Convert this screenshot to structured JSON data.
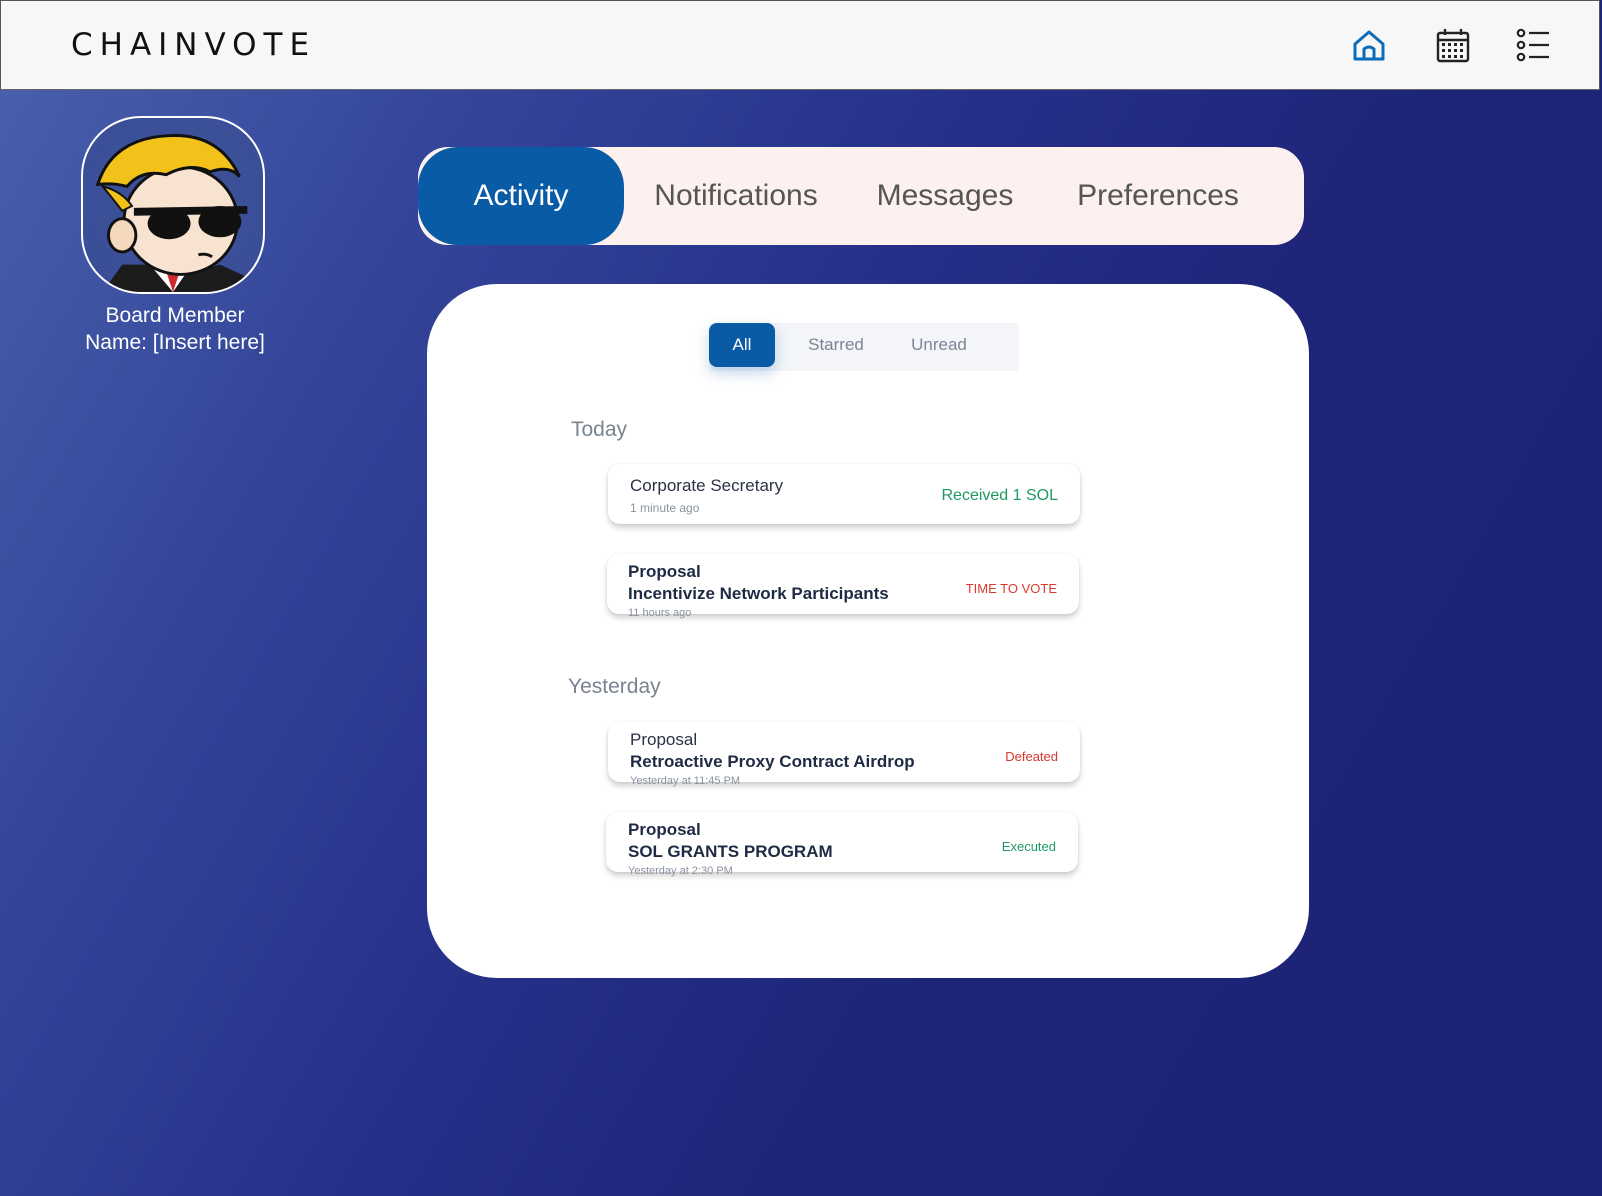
{
  "app": {
    "logo": "CHAINVOTE"
  },
  "nav": {
    "icons": [
      {
        "name": "home-icon",
        "color": "#0a6bb8"
      },
      {
        "name": "calendar-icon",
        "color": "#222222"
      },
      {
        "name": "list-icon",
        "color": "#222222"
      }
    ]
  },
  "profile": {
    "role": "Board Member",
    "name_line": "Name: [Insert here]"
  },
  "tabs": [
    {
      "label": "Activity",
      "active": true
    },
    {
      "label": "Notifications",
      "active": false
    },
    {
      "label": "Messages",
      "active": false
    },
    {
      "label": "Preferences",
      "active": false
    }
  ],
  "filters": [
    {
      "label": "All",
      "active": true
    },
    {
      "label": "Starred",
      "active": false
    },
    {
      "label": "Unread",
      "active": false
    }
  ],
  "sections": [
    {
      "label": "Today",
      "items": [
        {
          "line1": "Corporate Secretary",
          "line2": "",
          "time": "1 minute ago",
          "status": "Received 1 SOL",
          "status_color": "#1c9a62"
        },
        {
          "line1": "Proposal",
          "line2": "Incentivize Network Participants",
          "time": "11 hours ago",
          "status": "TIME TO VOTE",
          "status_color": "#d9382e"
        }
      ]
    },
    {
      "label": "Yesterday",
      "items": [
        {
          "line1": "Proposal",
          "line2": "Retroactive Proxy Contract Airdrop",
          "time": "Yesterday at 11:45 PM",
          "status": "Defeated",
          "status_color": "#d9382e"
        },
        {
          "line1": "Proposal",
          "line2": "SOL GRANTS PROGRAM",
          "time": "Yesterday at 2:30  PM",
          "status": "Executed",
          "status_color": "#1c9a62"
        }
      ]
    }
  ]
}
